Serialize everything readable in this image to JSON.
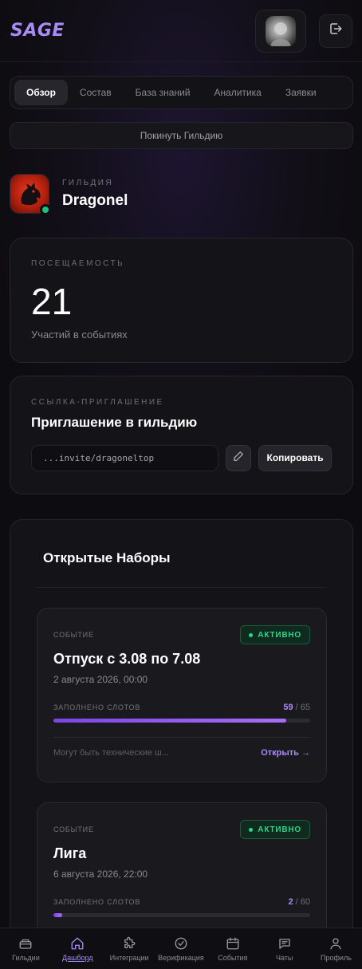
{
  "header": {
    "logo": "SAGE",
    "avatar_icon": "user-avatar",
    "logout_icon": "logout-icon"
  },
  "tabs": [
    {
      "label": "Обзор",
      "active": true
    },
    {
      "label": "Состав",
      "active": false
    },
    {
      "label": "База знаний",
      "active": false
    },
    {
      "label": "Аналитика",
      "active": false
    },
    {
      "label": "Заявки",
      "active": false
    }
  ],
  "leave_button": "Покинуть Гильдию",
  "guild": {
    "label": "ГИЛЬДИЯ",
    "name": "Dragonel",
    "online_color": "#22c07a"
  },
  "attendance": {
    "label": "ПОСЕЩАЕМОСТЬ",
    "value": "21",
    "subtitle": "Участий в событиях"
  },
  "invite": {
    "label": "ССЫЛКА-ПРИГЛАШЕНИЕ",
    "title": "Приглашение в гильдию",
    "link": "...invite/dragoneltop",
    "copy_label": "Копировать"
  },
  "recruitment": {
    "title": "Открытые Наборы",
    "events": [
      {
        "type": "СОБЫТИЕ",
        "status": "АКТИВНО",
        "title": "Отпуск с 3.08 по 7.08",
        "date": "2 августа 2026, 00:00",
        "slots_label": "ЗАПОЛНЕНО СЛОТОВ",
        "filled": "59",
        "total": "/ 65",
        "progress": 0.9077,
        "note": "Могут быть технические ш...",
        "open_label": "Открыть →"
      },
      {
        "type": "СОБЫТИЕ",
        "status": "АКТИВНО",
        "title": "Лига",
        "date": "6 августа 2026, 22:00",
        "slots_label": "ЗАПОЛНЕНО СЛОТОВ",
        "filled": "2",
        "total": "/ 60",
        "progress": 0.0333
      }
    ]
  },
  "accent_color": "#a98bf5",
  "bottom_nav": [
    {
      "label": "Гильдии",
      "icon": "guilds-icon",
      "active": false
    },
    {
      "label": "Дашборд",
      "icon": "home-icon",
      "active": true
    },
    {
      "label": "Интеграции",
      "icon": "puzzle-icon",
      "active": false
    },
    {
      "label": "Верификация",
      "icon": "check-circle-icon",
      "active": false
    },
    {
      "label": "События",
      "icon": "calendar-icon",
      "active": false
    },
    {
      "label": "Чаты",
      "icon": "chat-icon",
      "active": false
    },
    {
      "label": "Профиль",
      "icon": "user-icon",
      "active": false
    }
  ]
}
